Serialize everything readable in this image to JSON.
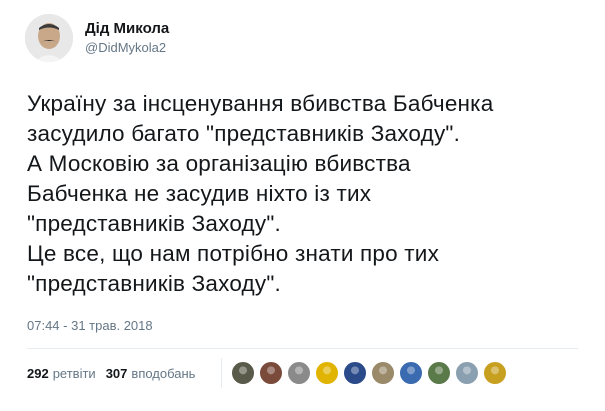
{
  "author": {
    "display_name": "Дід Микола",
    "handle": "@DidMykola2"
  },
  "tweet": {
    "lines": [
      "Україну за інсценування вбивства Бабченка",
      "засудило багато \"представників Заходу\".",
      "А Московію за організацію вбивства",
      "Бабченка не засудив ніхто із тих",
      "\"представників Заходу\".",
      "Це все, що нам потрібно знати про тих",
      "\"представників Заходу\"."
    ],
    "timestamp": "07:44 - 31 трав. 2018"
  },
  "stats": {
    "retweets_count": "292",
    "retweets_label": "ретвіти",
    "likes_count": "307",
    "likes_label": "вподобань"
  },
  "likers": [
    {
      "name": "liker-avatar-1",
      "color": "#5a5a4a"
    },
    {
      "name": "liker-avatar-2",
      "color": "#7a4a3a"
    },
    {
      "name": "liker-avatar-3",
      "color": "#8a8a8a"
    },
    {
      "name": "liker-avatar-4",
      "color": "#e0b400"
    },
    {
      "name": "liker-avatar-5",
      "color": "#2a4a8a"
    },
    {
      "name": "liker-avatar-6",
      "color": "#9a8a6a"
    },
    {
      "name": "liker-avatar-7",
      "color": "#3a6ab0"
    },
    {
      "name": "liker-avatar-8",
      "color": "#5a7a4a"
    },
    {
      "name": "liker-avatar-9",
      "color": "#8aa0b0"
    },
    {
      "name": "liker-avatar-10",
      "color": "#c8a020"
    }
  ],
  "colors": {
    "text_primary": "#14171a",
    "text_secondary": "#657786",
    "divider": "#e6ecf0"
  }
}
